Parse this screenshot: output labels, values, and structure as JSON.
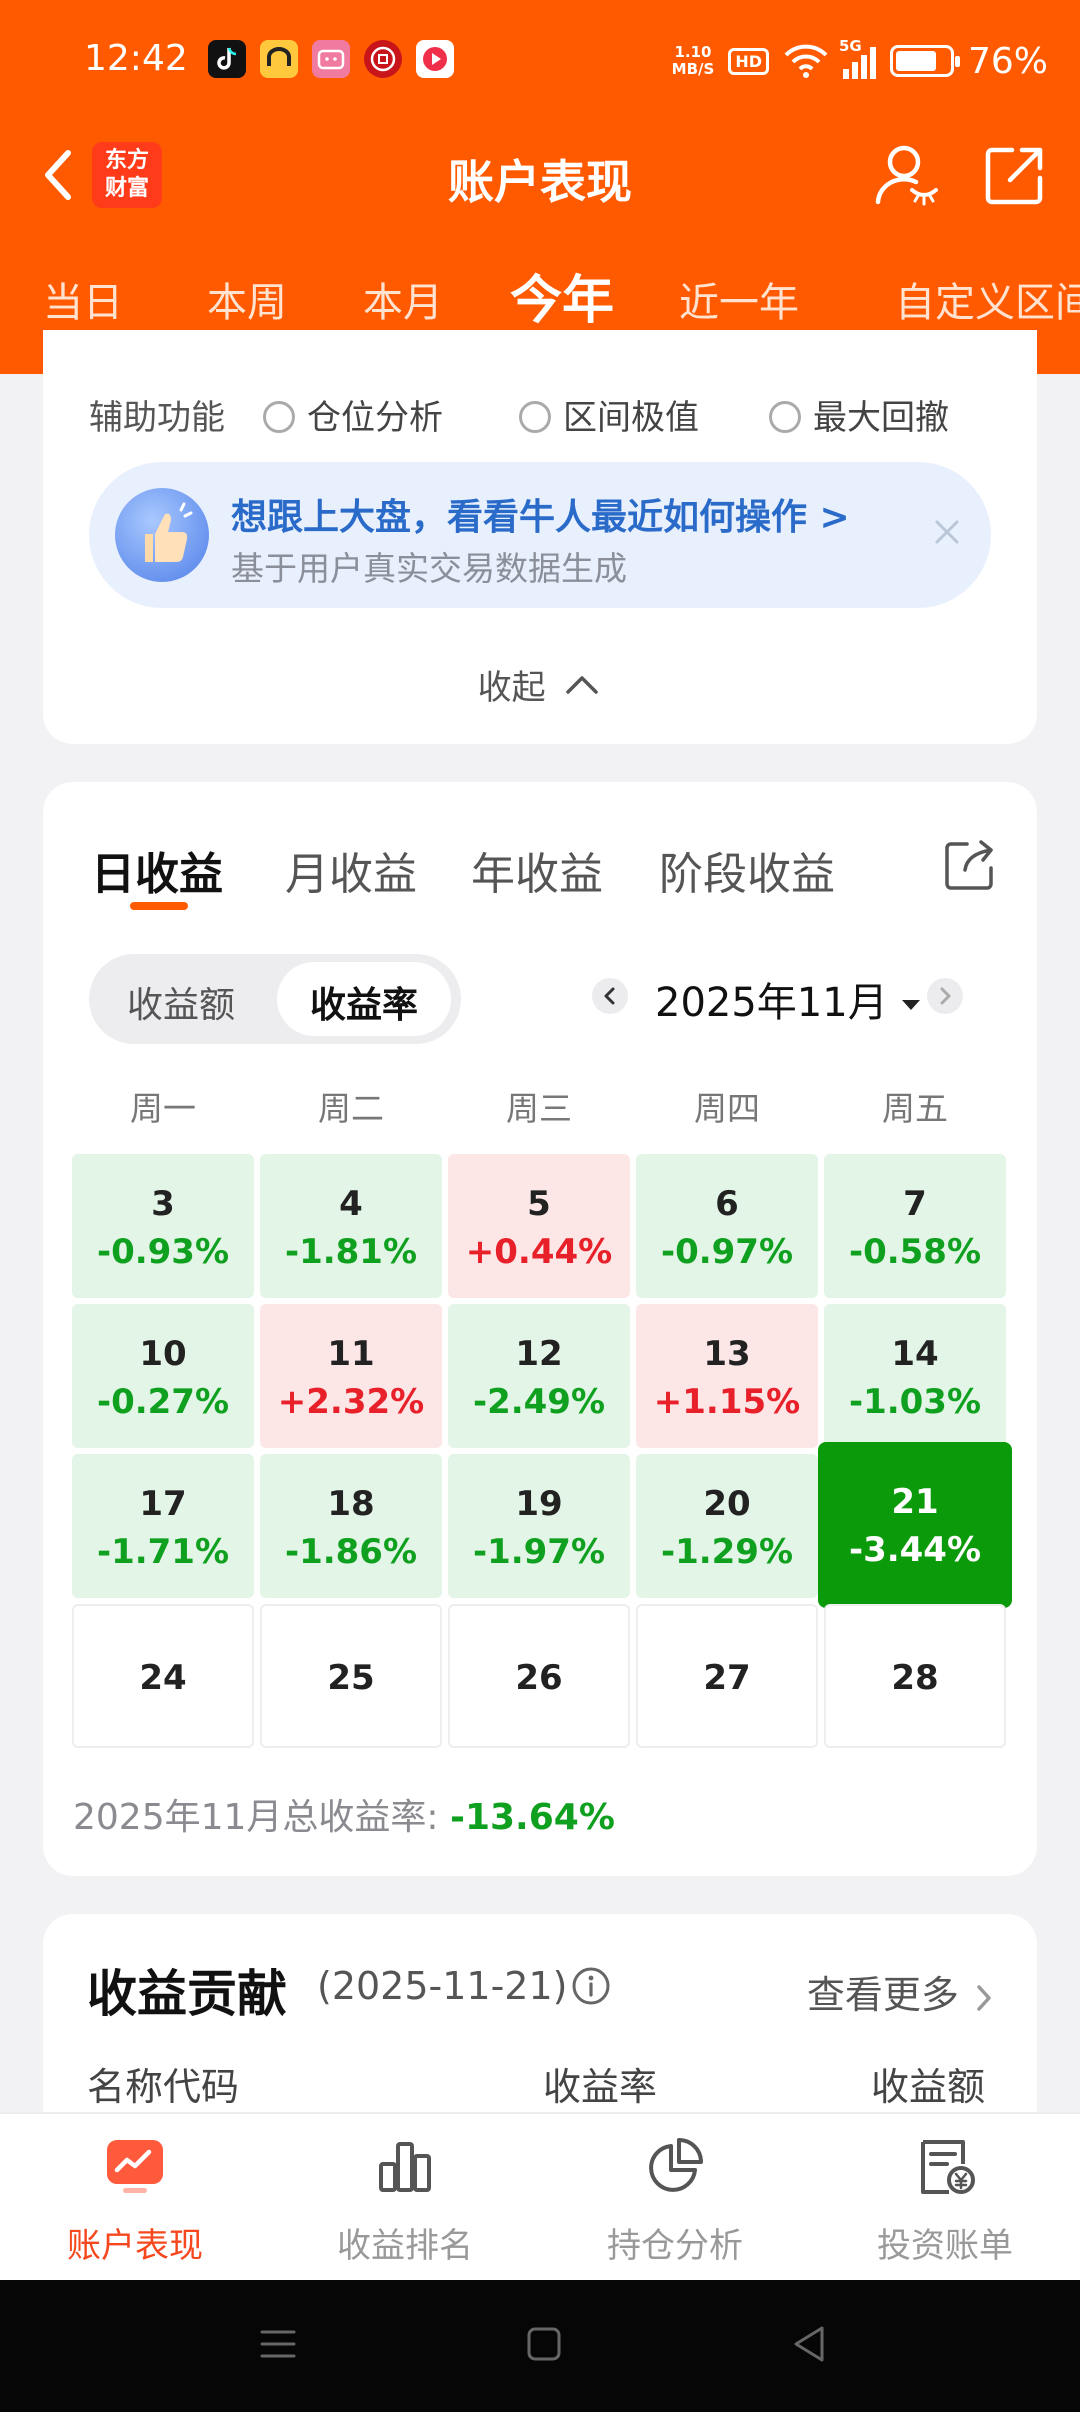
{
  "status_bar": {
    "time": "12:42",
    "net_speed_value": "1.10",
    "net_speed_unit": "MB/S",
    "hd_label": "HD",
    "signal_label": "5G",
    "battery_text": "76%",
    "battery_level": 0.76,
    "app_icons": [
      "tiktok-icon",
      "app-yellow-icon",
      "bilibili-icon",
      "bank-icon",
      "video-app-icon"
    ]
  },
  "header": {
    "title": "账户表现",
    "logo_line1": "东方",
    "logo_line2": "财富"
  },
  "period_tabs": [
    "当日",
    "本周",
    "本月",
    "今年",
    "近一年",
    "自定义区间"
  ],
  "period_active": "今年",
  "aux": {
    "label": "辅助功能",
    "options": [
      "仓位分析",
      "区间极值",
      "最大回撤"
    ]
  },
  "promo": {
    "title": "想跟上大盘，看看牛人最近如何操作 >",
    "subtitle": "基于用户真实交易数据生成"
  },
  "collapse_label": "收起",
  "returns": {
    "tabs": [
      "日收益",
      "月收益",
      "年收益",
      "阶段收益"
    ],
    "active_tab": "日收益",
    "toggle_amount": "收益额",
    "toggle_rate": "收益率",
    "month": "2025年11月",
    "weekdays": [
      "周一",
      "周二",
      "周三",
      "周四",
      "周五"
    ],
    "weeks": [
      [
        {
          "day": "3",
          "pct": "-0.93%",
          "type": "green"
        },
        {
          "day": "4",
          "pct": "-1.81%",
          "type": "green"
        },
        {
          "day": "5",
          "pct": "+0.44%",
          "type": "red"
        },
        {
          "day": "6",
          "pct": "-0.97%",
          "type": "green"
        },
        {
          "day": "7",
          "pct": "-0.58%",
          "type": "green"
        }
      ],
      [
        {
          "day": "10",
          "pct": "-0.27%",
          "type": "green"
        },
        {
          "day": "11",
          "pct": "+2.32%",
          "type": "red"
        },
        {
          "day": "12",
          "pct": "-2.49%",
          "type": "green"
        },
        {
          "day": "13",
          "pct": "+1.15%",
          "type": "red"
        },
        {
          "day": "14",
          "pct": "-1.03%",
          "type": "green"
        }
      ],
      [
        {
          "day": "17",
          "pct": "-1.71%",
          "type": "green"
        },
        {
          "day": "18",
          "pct": "-1.86%",
          "type": "green"
        },
        {
          "day": "19",
          "pct": "-1.97%",
          "type": "green"
        },
        {
          "day": "20",
          "pct": "-1.29%",
          "type": "green"
        },
        {
          "day": "21",
          "pct": "-3.44%",
          "type": "hl"
        }
      ],
      [
        {
          "day": "24",
          "pct": "",
          "type": "empty"
        },
        {
          "day": "25",
          "pct": "",
          "type": "empty"
        },
        {
          "day": "26",
          "pct": "",
          "type": "empty"
        },
        {
          "day": "27",
          "pct": "",
          "type": "empty"
        },
        {
          "day": "28",
          "pct": "",
          "type": "empty"
        }
      ]
    ],
    "total_label": "2025年11月总收益率:",
    "total_value": "-13.64%"
  },
  "contribution": {
    "title": "收益贡献",
    "date": "(2025-11-21)",
    "more": "查看更多",
    "columns": [
      "名称代码",
      "收益率",
      "收益额"
    ]
  },
  "bottom_nav": [
    {
      "label": "账户表现",
      "icon": "chart-trend-icon",
      "active": true
    },
    {
      "label": "收益排名",
      "icon": "bar-chart-icon",
      "active": false
    },
    {
      "label": "持仓分析",
      "icon": "pie-chart-icon",
      "active": false
    },
    {
      "label": "投资账单",
      "icon": "bill-yuan-icon",
      "active": false
    }
  ],
  "colors": {
    "brand_orange": "#ff5a00",
    "gain_red": "#e8202a",
    "loss_green": "#10a020",
    "highlight_green": "#0a9a0a"
  }
}
